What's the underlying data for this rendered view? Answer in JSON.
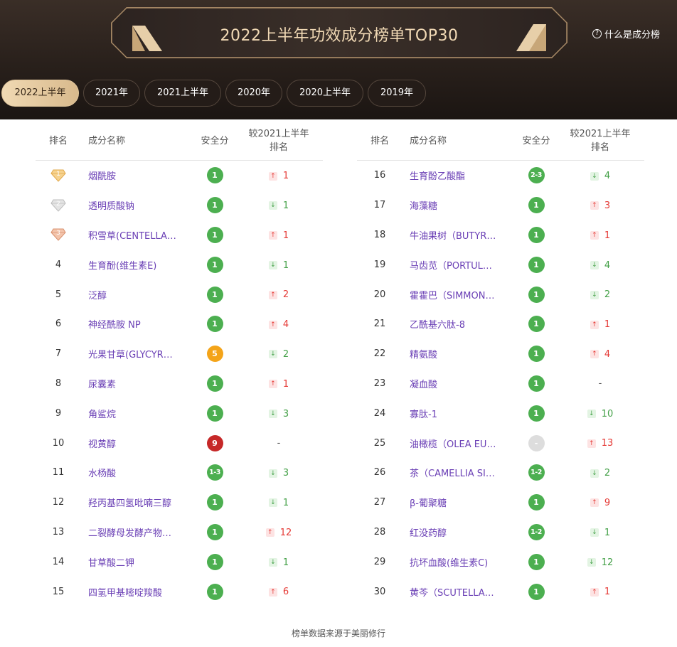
{
  "header": {
    "title": "2022上半年功效成分榜单TOP30",
    "help_label": "什么是成分榜"
  },
  "tabs": [
    {
      "label": "2022上半年",
      "active": true
    },
    {
      "label": "2021年",
      "active": false
    },
    {
      "label": "2021上半年",
      "active": false
    },
    {
      "label": "2020年",
      "active": false
    },
    {
      "label": "2020上半年",
      "active": false
    },
    {
      "label": "2019年",
      "active": false
    }
  ],
  "columns": {
    "rank": "排名",
    "name": "成分名称",
    "score": "安全分",
    "change_line1": "较2021上半年",
    "change_line2": "排名"
  },
  "left_rows": [
    {
      "rank": "1",
      "name": "烟酰胺",
      "score": "1",
      "score_color": "green",
      "dir": "up",
      "change": "1"
    },
    {
      "rank": "2",
      "name": "透明质酸钠",
      "score": "1",
      "score_color": "green",
      "dir": "down",
      "change": "1"
    },
    {
      "rank": "3",
      "name": "积雪草(CENTELLA…",
      "score": "1",
      "score_color": "green",
      "dir": "up",
      "change": "1"
    },
    {
      "rank": "4",
      "name": "生育酚(维生素E)",
      "score": "1",
      "score_color": "green",
      "dir": "down",
      "change": "1"
    },
    {
      "rank": "5",
      "name": "泛醇",
      "score": "1",
      "score_color": "green",
      "dir": "up",
      "change": "2"
    },
    {
      "rank": "6",
      "name": "神经酰胺 NP",
      "score": "1",
      "score_color": "green",
      "dir": "up",
      "change": "4"
    },
    {
      "rank": "7",
      "name": "光果甘草(GLYCYR…",
      "score": "5",
      "score_color": "orange",
      "dir": "down",
      "change": "2"
    },
    {
      "rank": "8",
      "name": "尿囊素",
      "score": "1",
      "score_color": "green",
      "dir": "up",
      "change": "1"
    },
    {
      "rank": "9",
      "name": "角鲨烷",
      "score": "1",
      "score_color": "green",
      "dir": "down",
      "change": "3"
    },
    {
      "rank": "10",
      "name": "视黄醇",
      "score": "9",
      "score_color": "red",
      "dir": "none",
      "change": "-"
    },
    {
      "rank": "11",
      "name": "水杨酸",
      "score": "1-3",
      "score_color": "green",
      "dir": "down",
      "change": "3"
    },
    {
      "rank": "12",
      "name": "羟丙基四氢吡喃三醇",
      "score": "1",
      "score_color": "green",
      "dir": "down",
      "change": "1"
    },
    {
      "rank": "13",
      "name": "二裂酵母发酵产物…",
      "score": "1",
      "score_color": "green",
      "dir": "up",
      "change": "12"
    },
    {
      "rank": "14",
      "name": "甘草酸二钾",
      "score": "1",
      "score_color": "green",
      "dir": "down",
      "change": "1"
    },
    {
      "rank": "15",
      "name": "四氢甲基嘧啶羧酸",
      "score": "1",
      "score_color": "green",
      "dir": "up",
      "change": "6"
    }
  ],
  "right_rows": [
    {
      "rank": "16",
      "name": "生育酚乙酸酯",
      "score": "2-3",
      "score_color": "green",
      "dir": "down",
      "change": "4"
    },
    {
      "rank": "17",
      "name": "海藻糖",
      "score": "1",
      "score_color": "green",
      "dir": "up",
      "change": "3"
    },
    {
      "rank": "18",
      "name": "牛油果树（BUTYR…",
      "score": "1",
      "score_color": "green",
      "dir": "up",
      "change": "1"
    },
    {
      "rank": "19",
      "name": "马齿苋（PORTUL…",
      "score": "1",
      "score_color": "green",
      "dir": "down",
      "change": "4"
    },
    {
      "rank": "20",
      "name": "霍霍巴（SIMMON…",
      "score": "1",
      "score_color": "green",
      "dir": "down",
      "change": "2"
    },
    {
      "rank": "21",
      "name": "乙酰基六肽-8",
      "score": "1",
      "score_color": "green",
      "dir": "up",
      "change": "1"
    },
    {
      "rank": "22",
      "name": "精氨酸",
      "score": "1",
      "score_color": "green",
      "dir": "up",
      "change": "4"
    },
    {
      "rank": "23",
      "name": "凝血酸",
      "score": "1",
      "score_color": "green",
      "dir": "none",
      "change": "-"
    },
    {
      "rank": "24",
      "name": "寡肽-1",
      "score": "1",
      "score_color": "green",
      "dir": "down",
      "change": "10"
    },
    {
      "rank": "25",
      "name": "油橄榄（OLEA EU…",
      "score": "-",
      "score_color": "gray",
      "dir": "up",
      "change": "13"
    },
    {
      "rank": "26",
      "name": "茶（CAMELLIA SI…",
      "score": "1-2",
      "score_color": "green",
      "dir": "down",
      "change": "2"
    },
    {
      "rank": "27",
      "name": "β-葡聚糖",
      "score": "1",
      "score_color": "green",
      "dir": "up",
      "change": "9"
    },
    {
      "rank": "28",
      "name": "红没药醇",
      "score": "1-2",
      "score_color": "green",
      "dir": "down",
      "change": "1"
    },
    {
      "rank": "29",
      "name": "抗坏血酸(维生素C)",
      "score": "1",
      "score_color": "green",
      "dir": "down",
      "change": "12"
    },
    {
      "rank": "30",
      "name": "黄芩（SCUTELLA…",
      "score": "1",
      "score_color": "green",
      "dir": "up",
      "change": "1"
    }
  ],
  "footer": "榜单数据来源于美丽修行",
  "colors": {
    "accent_gold": "#e8cda3",
    "name_purple": "#6a3fb5",
    "up_red": "#e53935",
    "down_green": "#43a047",
    "score_green": "#4caf50",
    "score_orange": "#f4a419",
    "score_red": "#c62828"
  }
}
